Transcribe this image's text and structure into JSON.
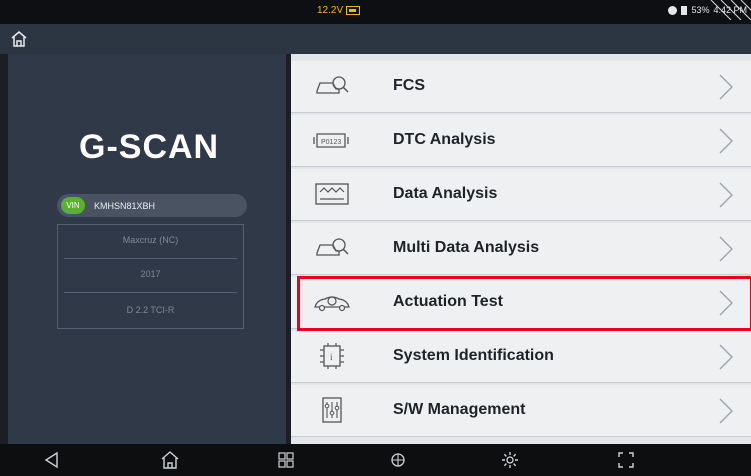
{
  "status": {
    "voltage": "12.2V",
    "battery_pct": "53%",
    "time": "4:42 PM"
  },
  "logo": "G-SCAN",
  "vehicle": {
    "vin_badge": "VIN",
    "vin": "KMHSN81XBH",
    "model": "Maxcruz (NC)",
    "year": "2017",
    "engine": "D 2.2 TCI-R"
  },
  "menu": [
    {
      "label": "FCS",
      "icon": "car-scan-icon"
    },
    {
      "label": "DTC Analysis",
      "icon": "engine-dtc-icon"
    },
    {
      "label": "Data Analysis",
      "icon": "waveform-icon"
    },
    {
      "label": "Multi Data Analysis",
      "icon": "car-scan-icon"
    },
    {
      "label": "Actuation Test",
      "icon": "car-actuation-icon"
    },
    {
      "label": "System Identification",
      "icon": "chip-icon"
    },
    {
      "label": "S/W Management",
      "icon": "sliders-icon"
    }
  ],
  "colors": {
    "highlight": "#e8001c",
    "vin_badge": "#5ab12e",
    "battery": "#f5b800"
  }
}
